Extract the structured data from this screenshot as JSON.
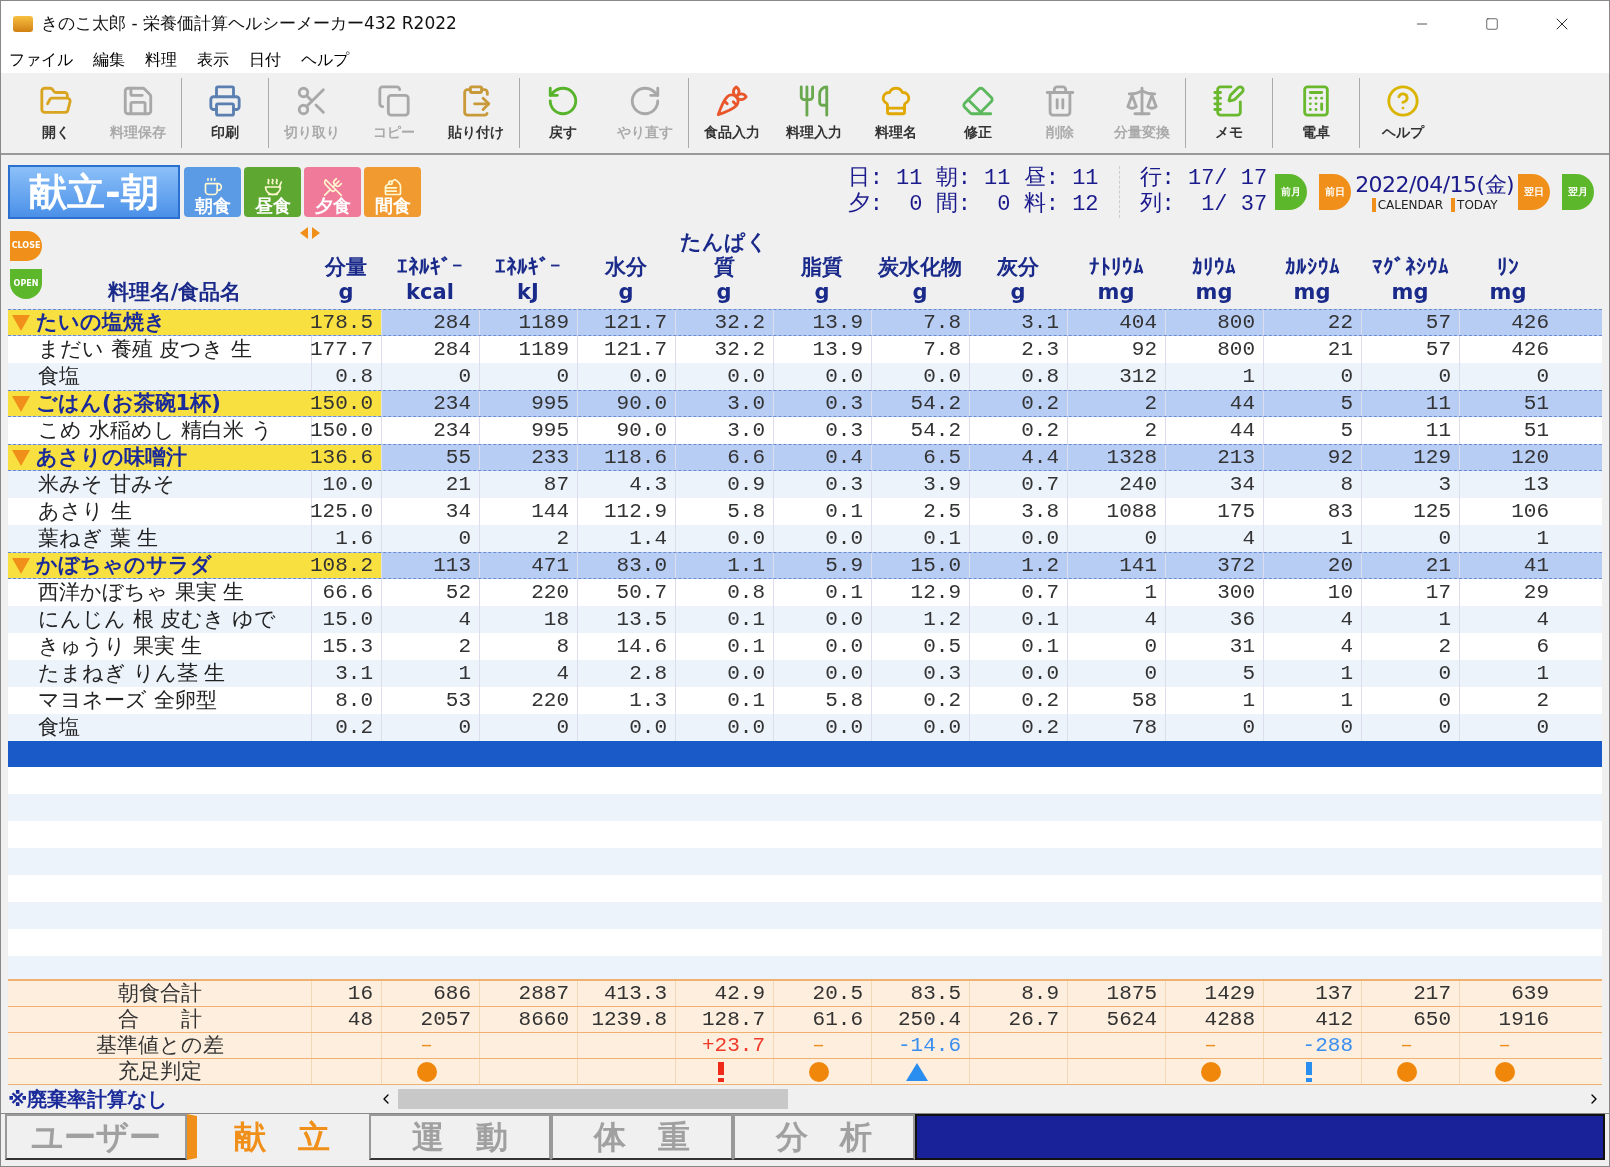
{
  "window": {
    "title": "きのこ太郎 - 栄養価計算ヘルシーメーカー432 R2022"
  },
  "menu": [
    "ファイル",
    "編集",
    "料理",
    "表示",
    "日付",
    "ヘルプ"
  ],
  "toolbar": [
    [
      {
        "label": "開く",
        "disabled": false
      },
      {
        "label": "料理保存",
        "disabled": true
      }
    ],
    [
      {
        "label": "印刷",
        "disabled": false
      }
    ],
    [
      {
        "label": "切り取り",
        "disabled": true
      },
      {
        "label": "コピー",
        "disabled": true
      },
      {
        "label": "貼り付け",
        "disabled": false
      }
    ],
    [
      {
        "label": "戻す",
        "disabled": false
      },
      {
        "label": "やり直す",
        "disabled": true
      }
    ],
    [
      {
        "label": "食品入力",
        "disabled": false
      },
      {
        "label": "料理入力",
        "disabled": false
      },
      {
        "label": "料理名",
        "disabled": false
      },
      {
        "label": "修正",
        "disabled": false
      },
      {
        "label": "削除",
        "disabled": true
      },
      {
        "label": "分量変換",
        "disabled": true
      }
    ],
    [
      {
        "label": "メモ",
        "disabled": false
      }
    ],
    [
      {
        "label": "電卓",
        "disabled": false
      }
    ],
    [
      {
        "label": "ヘルプ",
        "disabled": false
      }
    ]
  ],
  "mode_title": "献立-朝",
  "meals": [
    {
      "label": "朝食",
      "kind": "breakfast"
    },
    {
      "label": "昼食",
      "kind": "lunch"
    },
    {
      "label": "夕食",
      "kind": "dinner"
    },
    {
      "label": "間食",
      "kind": "snack"
    }
  ],
  "counts": {
    "line1": "日: 11 朝: 11 昼: 11",
    "line2": "夕:  0 間:  0 料: 12",
    "row": "行: 17/ 17",
    "col": "列:  1/ 37"
  },
  "date_nav": {
    "prev_month": "前月",
    "prev_day": "前日",
    "date": "2022/04/15(金)",
    "calendar": "CALENDAR",
    "today": "TODAY",
    "next_day": "翌日",
    "next_month": "翌月"
  },
  "close_button": "CLOSE",
  "open_button": "OPEN",
  "columns": [
    {
      "lines": [
        "料理名/食品名"
      ]
    },
    {
      "lines": [
        "分量",
        "g"
      ]
    },
    {
      "lines": [
        "ｴﾈﾙｷﾞｰ",
        "kcal"
      ]
    },
    {
      "lines": [
        "ｴﾈﾙｷﾞｰ",
        "kJ"
      ]
    },
    {
      "lines": [
        "水分",
        "g"
      ]
    },
    {
      "lines": [
        "たんぱく",
        "質",
        "g"
      ]
    },
    {
      "lines": [
        "脂質",
        "g"
      ]
    },
    {
      "lines": [
        "炭水化物",
        "g"
      ]
    },
    {
      "lines": [
        "灰分",
        "g"
      ]
    },
    {
      "lines": [
        "ﾅﾄﾘｳﾑ",
        "mg"
      ]
    },
    {
      "lines": [
        "ｶﾘｳﾑ",
        "mg"
      ]
    },
    {
      "lines": [
        "ｶﾙｼｳﾑ",
        "mg"
      ]
    },
    {
      "lines": [
        "ﾏｸﾞﾈｼｳﾑ",
        "mg"
      ]
    },
    {
      "lines": [
        "ﾘﾝ",
        "mg"
      ]
    }
  ],
  "rows": [
    {
      "kind": "dish",
      "name": "たいの塩焼き",
      "values": [
        "178.5",
        "284",
        "1189",
        "121.7",
        "32.2",
        "13.9",
        "7.8",
        "3.1",
        "404",
        "800",
        "22",
        "57",
        "426"
      ]
    },
    {
      "kind": "food",
      "name": "まだい 養殖 皮つき 生",
      "values": [
        "177.7",
        "284",
        "1189",
        "121.7",
        "32.2",
        "13.9",
        "7.8",
        "2.3",
        "92",
        "800",
        "21",
        "57",
        "426"
      ]
    },
    {
      "kind": "food",
      "name": "食塩",
      "values": [
        "0.8",
        "0",
        "0",
        "0.0",
        "0.0",
        "0.0",
        "0.0",
        "0.8",
        "312",
        "1",
        "0",
        "0",
        "0"
      ]
    },
    {
      "kind": "dish",
      "name": "ごはん(お茶碗1杯)",
      "values": [
        "150.0",
        "234",
        "995",
        "90.0",
        "3.0",
        "0.3",
        "54.2",
        "0.2",
        "2",
        "44",
        "5",
        "11",
        "51"
      ]
    },
    {
      "kind": "food",
      "name": "こめ 水稲めし 精白米 う",
      "values": [
        "150.0",
        "234",
        "995",
        "90.0",
        "3.0",
        "0.3",
        "54.2",
        "0.2",
        "2",
        "44",
        "5",
        "11",
        "51"
      ]
    },
    {
      "kind": "dish",
      "name": "あさりの味噌汁",
      "values": [
        "136.6",
        "55",
        "233",
        "118.6",
        "6.6",
        "0.4",
        "6.5",
        "4.4",
        "1328",
        "213",
        "92",
        "129",
        "120"
      ]
    },
    {
      "kind": "food",
      "name": "米みそ 甘みそ",
      "values": [
        "10.0",
        "21",
        "87",
        "4.3",
        "0.9",
        "0.3",
        "3.9",
        "0.7",
        "240",
        "34",
        "8",
        "3",
        "13"
      ]
    },
    {
      "kind": "food",
      "name": "あさり 生",
      "values": [
        "125.0",
        "34",
        "144",
        "112.9",
        "5.8",
        "0.1",
        "2.5",
        "3.8",
        "1088",
        "175",
        "83",
        "125",
        "106"
      ]
    },
    {
      "kind": "food",
      "name": "葉ねぎ 葉 生",
      "values": [
        "1.6",
        "0",
        "2",
        "1.4",
        "0.0",
        "0.0",
        "0.1",
        "0.0",
        "0",
        "4",
        "1",
        "0",
        "1"
      ]
    },
    {
      "kind": "dish",
      "name": "かぼちゃのサラダ",
      "values": [
        "108.2",
        "113",
        "471",
        "83.0",
        "1.1",
        "5.9",
        "15.0",
        "1.2",
        "141",
        "372",
        "20",
        "21",
        "41"
      ]
    },
    {
      "kind": "food",
      "name": "西洋かぼちゃ 果実 生",
      "values": [
        "66.6",
        "52",
        "220",
        "50.7",
        "0.8",
        "0.1",
        "12.9",
        "0.7",
        "1",
        "300",
        "10",
        "17",
        "29"
      ]
    },
    {
      "kind": "food",
      "name": "にんじん 根 皮むき ゆで",
      "values": [
        "15.0",
        "4",
        "18",
        "13.5",
        "0.1",
        "0.0",
        "1.2",
        "0.1",
        "4",
        "36",
        "4",
        "1",
        "4"
      ]
    },
    {
      "kind": "food",
      "name": "きゅうり 果実 生",
      "values": [
        "15.3",
        "2",
        "8",
        "14.6",
        "0.1",
        "0.0",
        "0.5",
        "0.1",
        "0",
        "31",
        "4",
        "2",
        "6"
      ]
    },
    {
      "kind": "food",
      "name": "たまねぎ りん茎 生",
      "values": [
        "3.1",
        "1",
        "4",
        "2.8",
        "0.0",
        "0.0",
        "0.3",
        "0.0",
        "0",
        "5",
        "1",
        "0",
        "1"
      ]
    },
    {
      "kind": "food",
      "name": "マヨネーズ 全卵型",
      "values": [
        "8.0",
        "53",
        "220",
        "1.3",
        "0.1",
        "5.8",
        "0.2",
        "0.2",
        "58",
        "1",
        "1",
        "0",
        "2"
      ]
    },
    {
      "kind": "food",
      "name": "食塩",
      "values": [
        "0.2",
        "0",
        "0",
        "0.0",
        "0.0",
        "0.0",
        "0.0",
        "0.2",
        "78",
        "0",
        "0",
        "0",
        "0"
      ]
    }
  ],
  "summary": [
    {
      "kind": "values",
      "label": "朝食合計",
      "values": [
        "16",
        "686",
        "2887",
        "413.3",
        "42.9",
        "20.5",
        "83.5",
        "8.9",
        "1875",
        "1429",
        "137",
        "217",
        "639"
      ]
    },
    {
      "kind": "values",
      "label": "合　　計",
      "values": [
        "48",
        "2057",
        "8660",
        "1239.8",
        "128.7",
        "61.6",
        "250.4",
        "26.7",
        "5624",
        "4288",
        "412",
        "650",
        "1916"
      ]
    },
    {
      "kind": "diff",
      "label": "基準値との差",
      "values": [
        {
          "kind": "blank"
        },
        {
          "kind": "dash",
          "text": "–",
          "color": "#f08a1a"
        },
        {
          "kind": "blank"
        },
        {
          "kind": "blank"
        },
        {
          "kind": "number",
          "text": "+23.7",
          "color": "#f03a2a"
        },
        {
          "kind": "dash",
          "text": "–",
          "color": "#f08a1a"
        },
        {
          "kind": "number",
          "text": "-14.6",
          "color": "#3a8ef0"
        },
        {
          "kind": "blank"
        },
        {
          "kind": "blank"
        },
        {
          "kind": "dash",
          "text": "–",
          "color": "#f08a1a"
        },
        {
          "kind": "number",
          "text": "-288",
          "color": "#3a8ef0"
        },
        {
          "kind": "dash",
          "text": "–",
          "color": "#f08a1a"
        },
        {
          "kind": "dash",
          "text": "–",
          "color": "#f08a1a"
        }
      ]
    },
    {
      "kind": "judge",
      "label": "充足判定",
      "values": [
        {
          "kind": "blank"
        },
        {
          "kind": "circle",
          "color": "#f0870a"
        },
        {
          "kind": "blank"
        },
        {
          "kind": "blank"
        },
        {
          "kind": "exclamation",
          "color": "#f02a1a"
        },
        {
          "kind": "circle",
          "color": "#f0870a"
        },
        {
          "kind": "triangle",
          "color": "#2a8ef0"
        },
        {
          "kind": "blank"
        },
        {
          "kind": "blank"
        },
        {
          "kind": "circle",
          "color": "#f0870a"
        },
        {
          "kind": "exclamation",
          "color": "#2a8ef0"
        },
        {
          "kind": "circle",
          "color": "#f0870a"
        },
        {
          "kind": "circle",
          "color": "#f0870a"
        }
      ]
    }
  ],
  "footnote": "※廃棄率計算なし",
  "tabs": [
    {
      "label": "ユーザー",
      "selected": false
    },
    {
      "label": "献　立",
      "selected": true
    },
    {
      "label": "運　動",
      "selected": false
    },
    {
      "label": "体　重",
      "selected": false
    },
    {
      "label": "分　析",
      "selected": false
    }
  ]
}
